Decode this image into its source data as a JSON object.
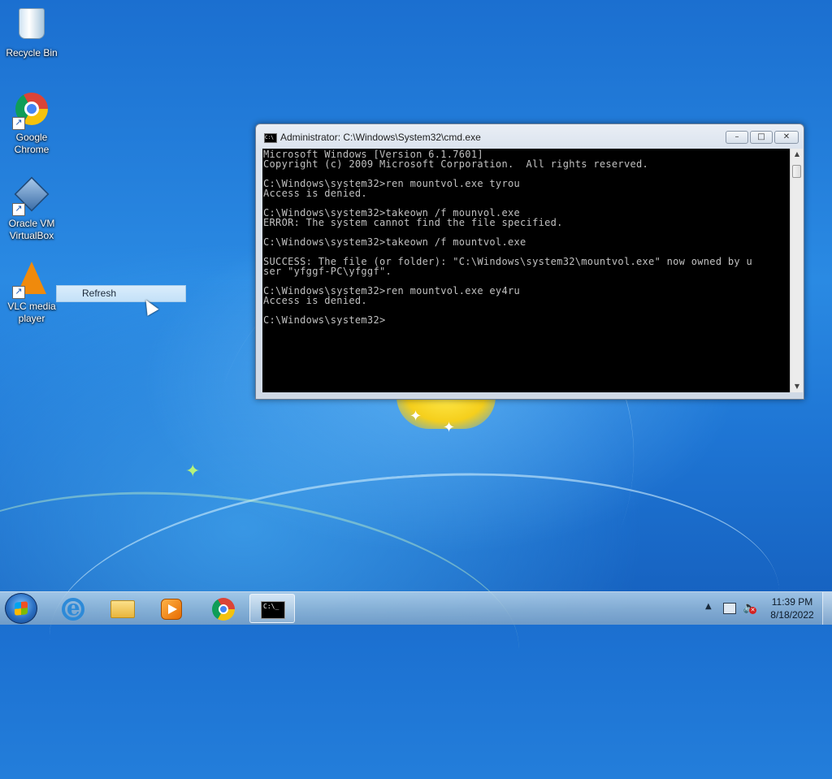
{
  "desktop": {
    "icons": [
      {
        "label": "Recycle Bin",
        "icon": "recycle-bin-icon"
      },
      {
        "label": "Google Chrome",
        "icon": "chrome-icon"
      },
      {
        "label": "Oracle VM VirtualBox",
        "icon": "virtualbox-icon"
      },
      {
        "label": "VLC media player",
        "icon": "vlc-icon"
      }
    ],
    "context_menu": {
      "item": "Refresh"
    }
  },
  "cmd_window": {
    "title": "Administrator: C:\\Windows\\System32\\cmd.exe",
    "title_icon_text": "C:\\",
    "lines": [
      "Microsoft Windows [Version 6.1.7601]",
      "Copyright (c) 2009 Microsoft Corporation.  All rights reserved.",
      "",
      "C:\\Windows\\system32>ren mountvol.exe tyrou",
      "Access is denied.",
      "",
      "C:\\Windows\\system32>takeown /f mounvol.exe",
      "ERROR: The system cannot find the file specified.",
      "",
      "C:\\Windows\\system32>takeown /f mountvol.exe",
      "",
      "SUCCESS: The file (or folder): \"C:\\Windows\\system32\\mountvol.exe\" now owned by u",
      "ser \"yfggf-PC\\yfggf\".",
      "",
      "C:\\Windows\\system32>ren mountvol.exe ey4ru",
      "Access is denied.",
      "",
      "C:\\Windows\\system32>"
    ]
  },
  "taskbar": {
    "pinned": [
      "internet-explorer-icon",
      "windows-explorer-icon",
      "media-player-icon",
      "chrome-icon",
      "cmd-icon"
    ],
    "active": "cmd-icon",
    "cmd_icon_text": "C:\\_",
    "clock": {
      "time": "11:39 PM",
      "date": "8/18/2022"
    }
  }
}
